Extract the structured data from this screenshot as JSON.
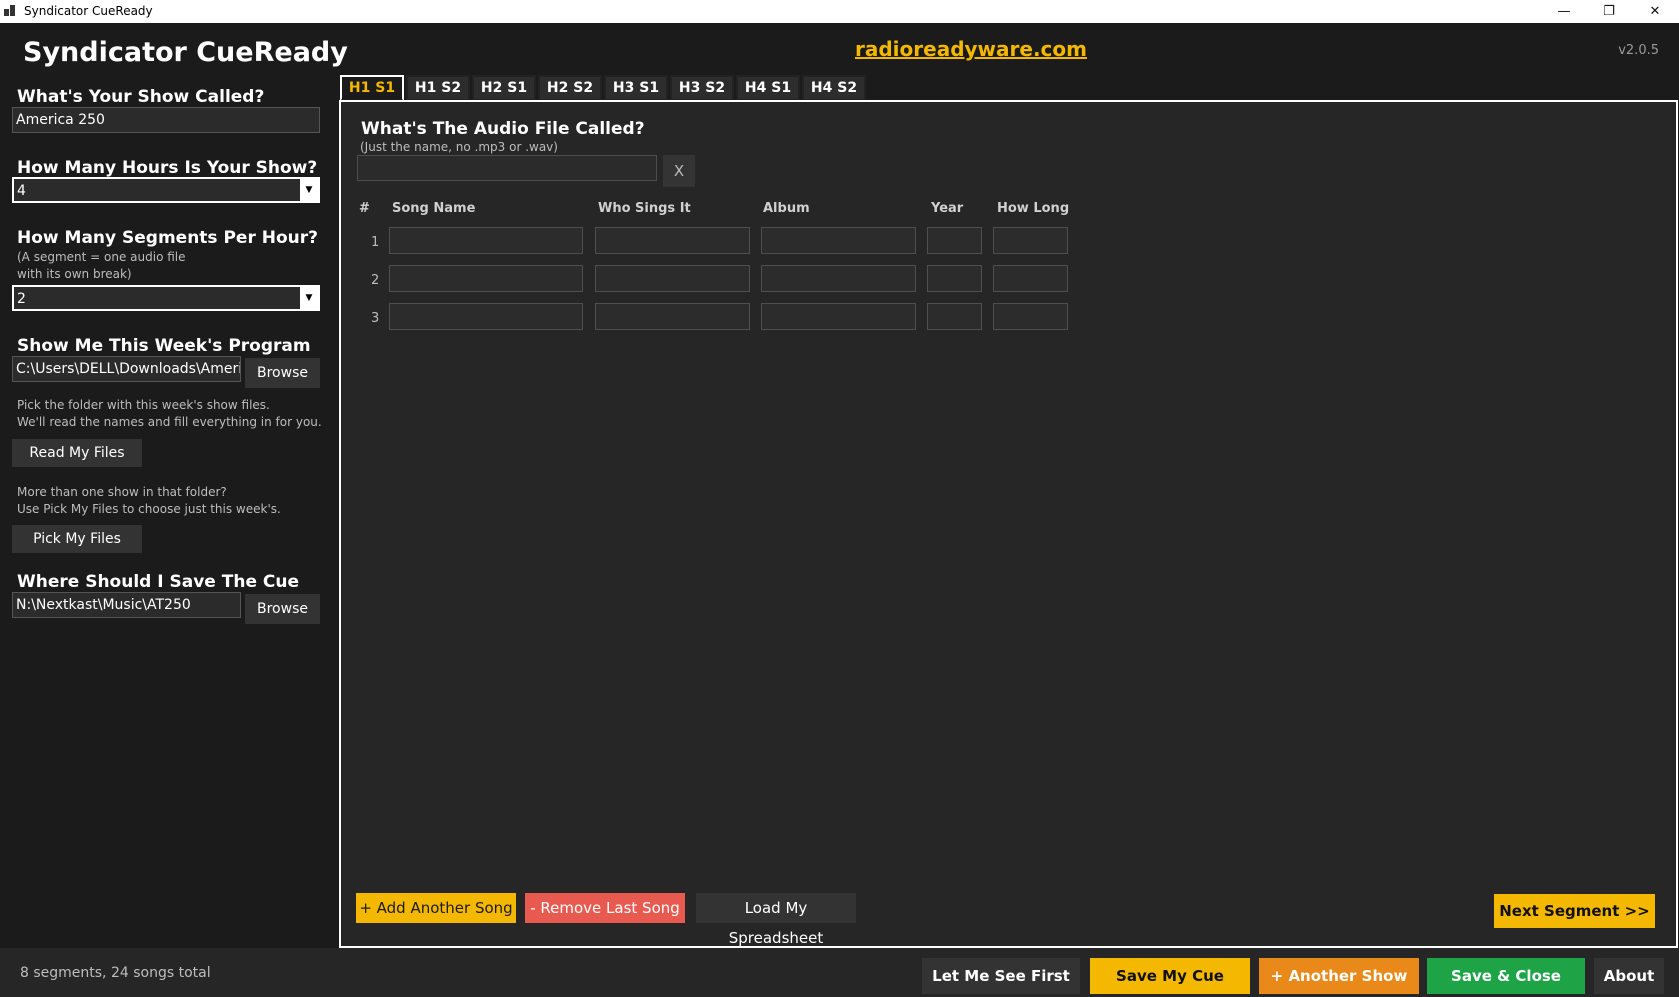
{
  "window": {
    "title": "Syndicator CueReady",
    "minimize": "—",
    "maximize": "❐",
    "close": "✕"
  },
  "header": {
    "app_title": "Syndicator CueReady",
    "site": "radioreadyware.com",
    "version": "v2.0.5"
  },
  "sidebar": {
    "show_name_label": "What's Your Show Called?",
    "show_name_value": "America 250",
    "hours_label": "How Many Hours Is Your Show?",
    "hours_value": "4",
    "segments_label": "How Many Segments Per Hour?",
    "segments_sub1": "(A segment = one audio file",
    "segments_sub2": "with its own break)",
    "segments_value": "2",
    "program_files_label": "Show Me This Week's Program Files",
    "program_files_path": "C:\\Users\\DELL\\Downloads\\Americ",
    "browse_label": "Browse",
    "help1_line1": "Pick the folder with this week's show files.",
    "help1_line2": "We'll read the names and fill everything in for you.",
    "read_files_label": "Read My Files",
    "help2_line1": "More than one show in that folder?",
    "help2_line2": "Use Pick My Files to choose just this week's.",
    "pick_files_label": "Pick My Files",
    "save_location_label": "Where Should I Save The Cue Files?",
    "save_location_path": "N:\\Nextkast\\Music\\AT250",
    "browse2_label": "Browse"
  },
  "tabs": [
    "H1 S1",
    "H1 S2",
    "H2 S1",
    "H2 S2",
    "H3 S1",
    "H3 S2",
    "H4 S1",
    "H4 S2"
  ],
  "active_tab": "H1 S1",
  "panel": {
    "audio_title": "What's The Audio File Called?",
    "audio_sub": "(Just the name, no .mp3 or .wav)",
    "audio_value": "",
    "clear_label": "X",
    "columns": {
      "num": "#",
      "song": "Song Name",
      "artist": "Who Sings It",
      "album": "Album",
      "year": "Year",
      "length": "How Long"
    },
    "rows": [
      "1",
      "2",
      "3"
    ],
    "add_song": "+ Add Another Song",
    "remove_song": "- Remove Last Song",
    "load_sheet": "Load My Spreadsheet",
    "next_segment": "Next Segment  >>"
  },
  "footer": {
    "status": "8 segments, 24 songs total",
    "preview": "Let Me See First",
    "save_cues": "Save My Cue Sheets",
    "another_show": "+ Another Show",
    "save_close": "Save & Close",
    "about": "About"
  },
  "colors": {
    "accent_yellow": "#f5b800",
    "remove_red": "#e85a4f",
    "orange": "#e8891a",
    "green": "#1fa347",
    "background": "#1b1b1b"
  }
}
